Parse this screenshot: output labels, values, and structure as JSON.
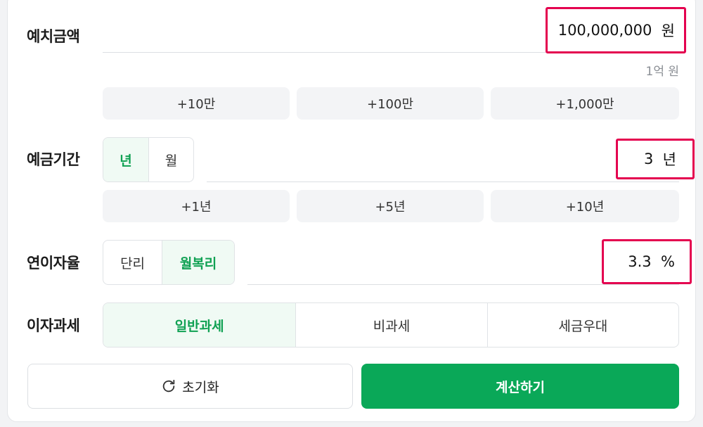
{
  "deposit": {
    "label": "예치금액",
    "value": "100,000,000",
    "unit": "원",
    "hint": "1억 원",
    "quick_add": [
      "+10만",
      "+100만",
      "+1,000만"
    ]
  },
  "period": {
    "label": "예금기간",
    "options": [
      {
        "label": "년",
        "active": true
      },
      {
        "label": "월",
        "active": false
      }
    ],
    "value": "3",
    "unit": "년",
    "quick_add": [
      "+1년",
      "+5년",
      "+10년"
    ]
  },
  "rate": {
    "label": "연이자율",
    "options": [
      {
        "label": "단리",
        "active": false
      },
      {
        "label": "월복리",
        "active": true
      }
    ],
    "value": "3.3",
    "unit": "%"
  },
  "tax": {
    "label": "이자과세",
    "options": [
      {
        "label": "일반과세",
        "active": true
      },
      {
        "label": "비과세",
        "active": false
      },
      {
        "label": "세금우대",
        "active": false
      }
    ]
  },
  "actions": {
    "reset_label": "초기화",
    "calc_label": "계산하기",
    "reset_icon": "refresh-icon"
  },
  "colors": {
    "accent": "#0aa858",
    "accent_text": "#10a153",
    "highlight": "#e4004f"
  }
}
